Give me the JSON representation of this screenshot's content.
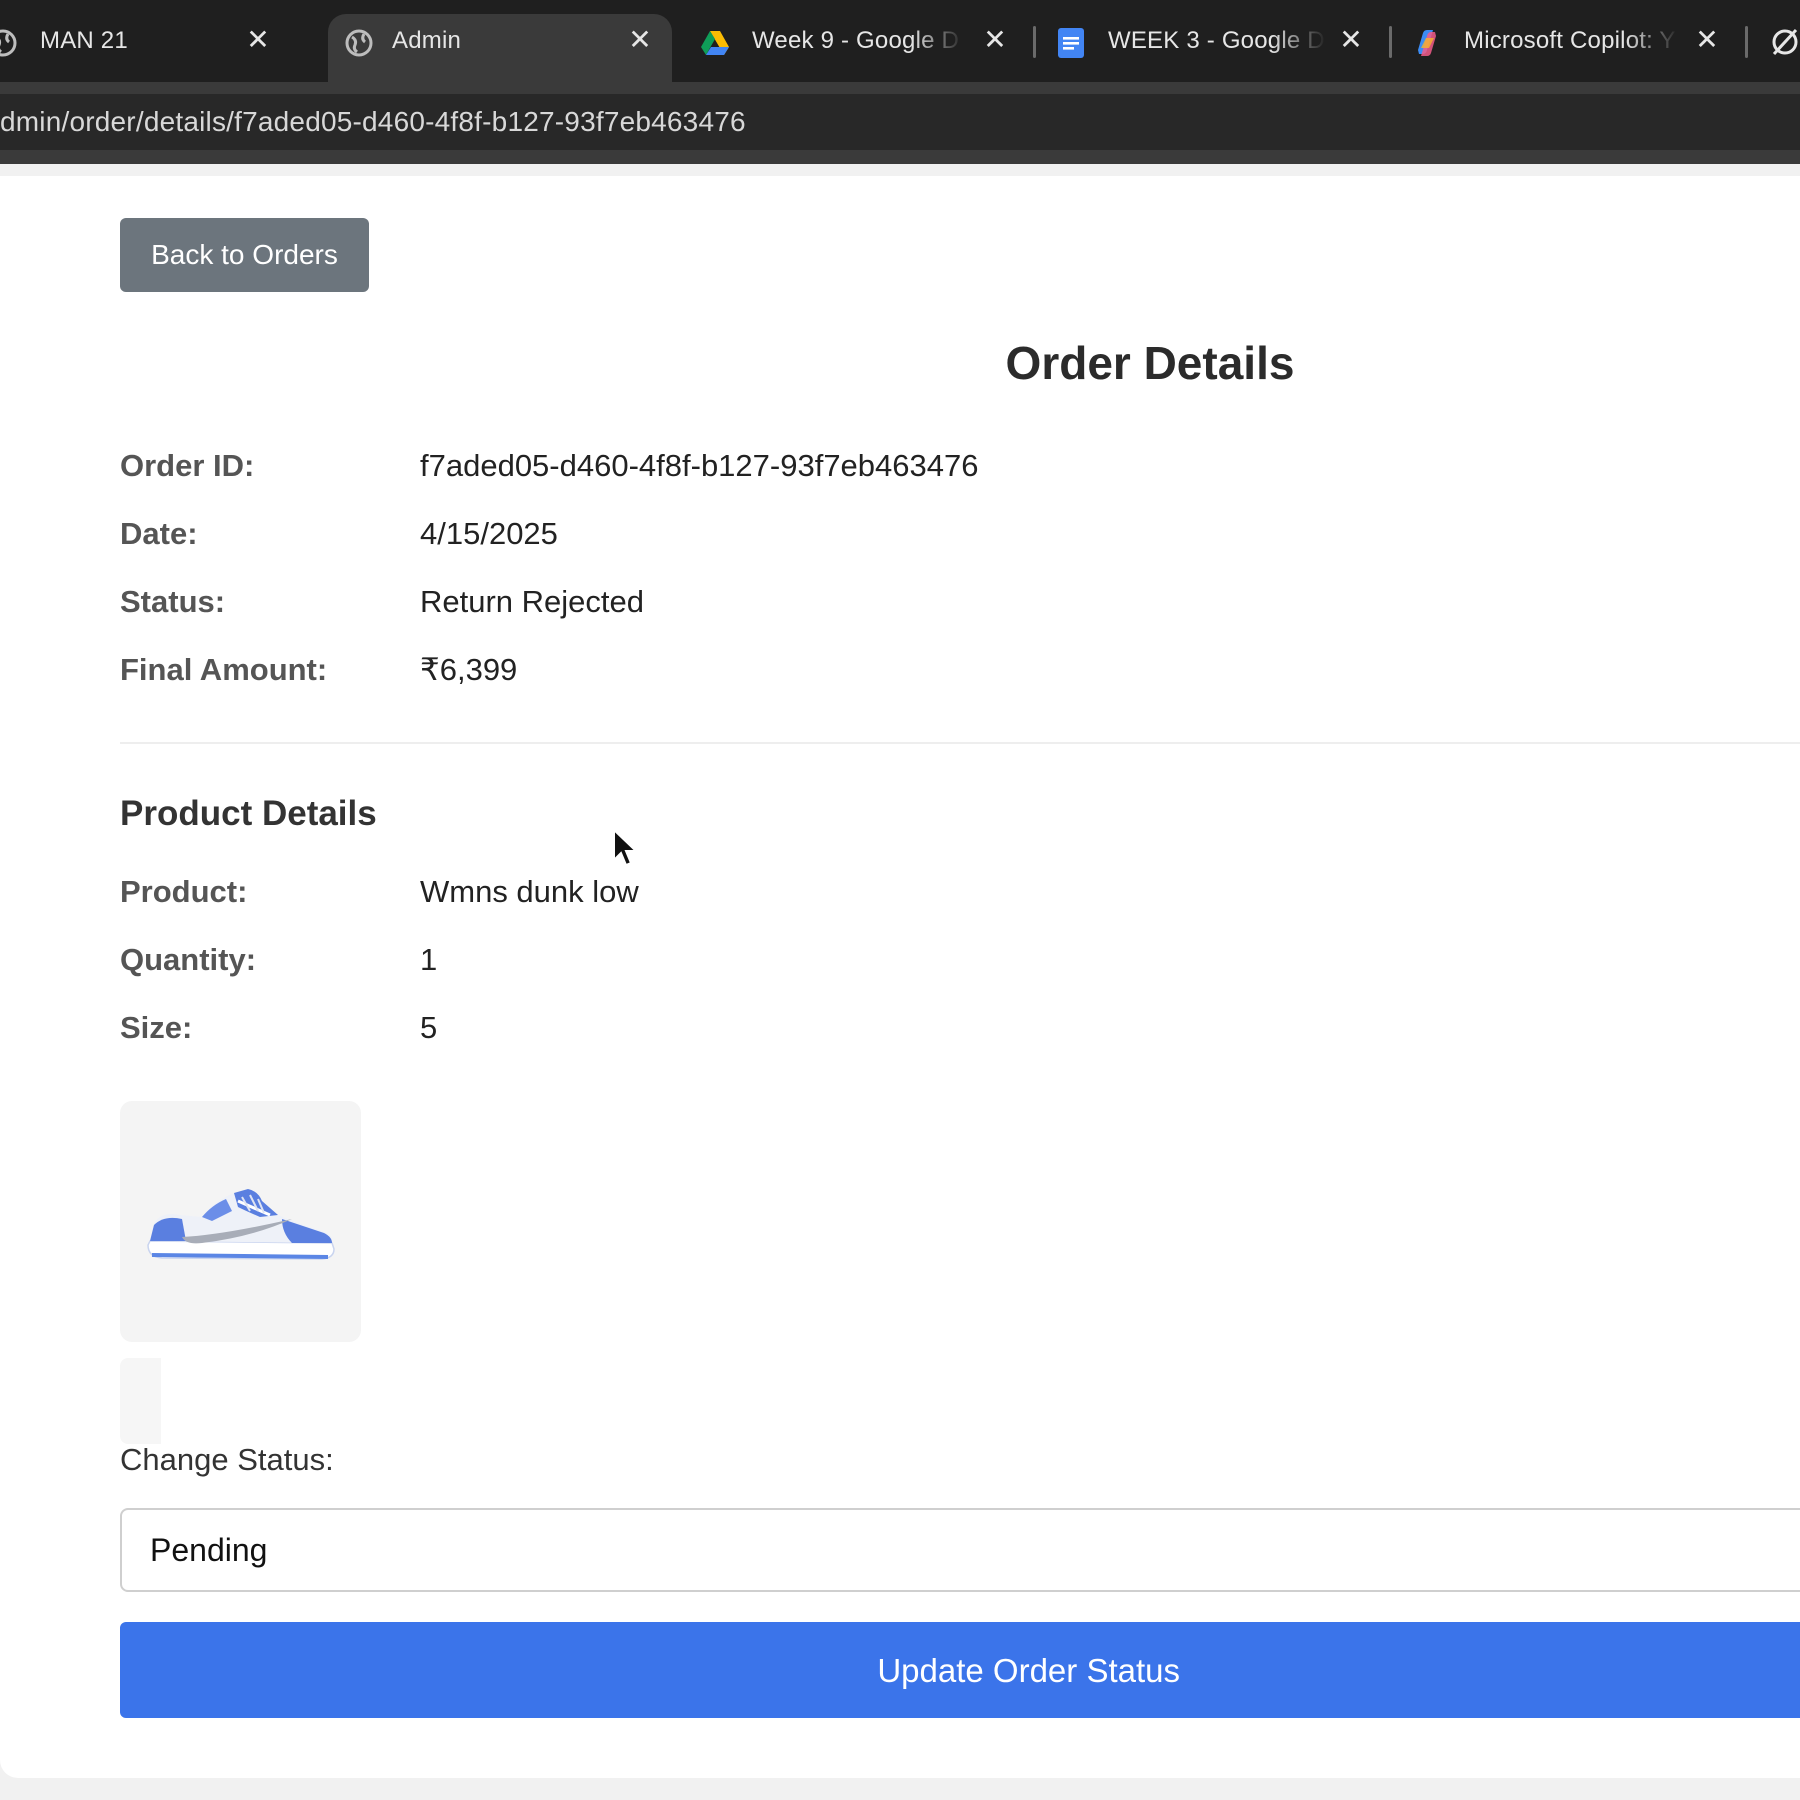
{
  "browser": {
    "tabs": [
      {
        "title": "MAN 21",
        "icon": "globe-icon",
        "active": false
      },
      {
        "title": "Admin",
        "icon": "globe-icon",
        "active": true
      },
      {
        "title": "Week 9 - Google D",
        "icon": "google-drive-icon",
        "active": false
      },
      {
        "title": "WEEK 3 - Google D",
        "icon": "google-docs-icon",
        "active": false
      },
      {
        "title": "Microsoft Copilot: Y",
        "icon": "copilot-icon",
        "active": false
      }
    ],
    "close_glyph": "✕",
    "url": "dmin/order/details/f7aded05-d460-4f8f-b127-93f7eb463476"
  },
  "page": {
    "back_button": "Back to Orders",
    "title": "Order Details",
    "order": [
      {
        "label": "Order ID:",
        "value": "f7aded05-d460-4f8f-b127-93f7eb463476"
      },
      {
        "label": "Date:",
        "value": "4/15/2025"
      },
      {
        "label": "Status:",
        "value": "Return Rejected"
      },
      {
        "label": "Final Amount:",
        "value": "₹6,399"
      }
    ],
    "product_section_title": "Product Details",
    "product": [
      {
        "label": "Product:",
        "value": "Wmns dunk low"
      },
      {
        "label": "Quantity:",
        "value": "1"
      },
      {
        "label": "Size:",
        "value": "5"
      }
    ],
    "product_image": "blue-white-sneaker-image",
    "change_status_label": "Change Status:",
    "status_selected": "Pending",
    "update_button": "Update Order Status"
  },
  "colors": {
    "tab_bar": "#1f1f1f",
    "active_tab": "#3a3a3a",
    "back_button": "#6c757d",
    "primary_button": "#3b74ea"
  }
}
